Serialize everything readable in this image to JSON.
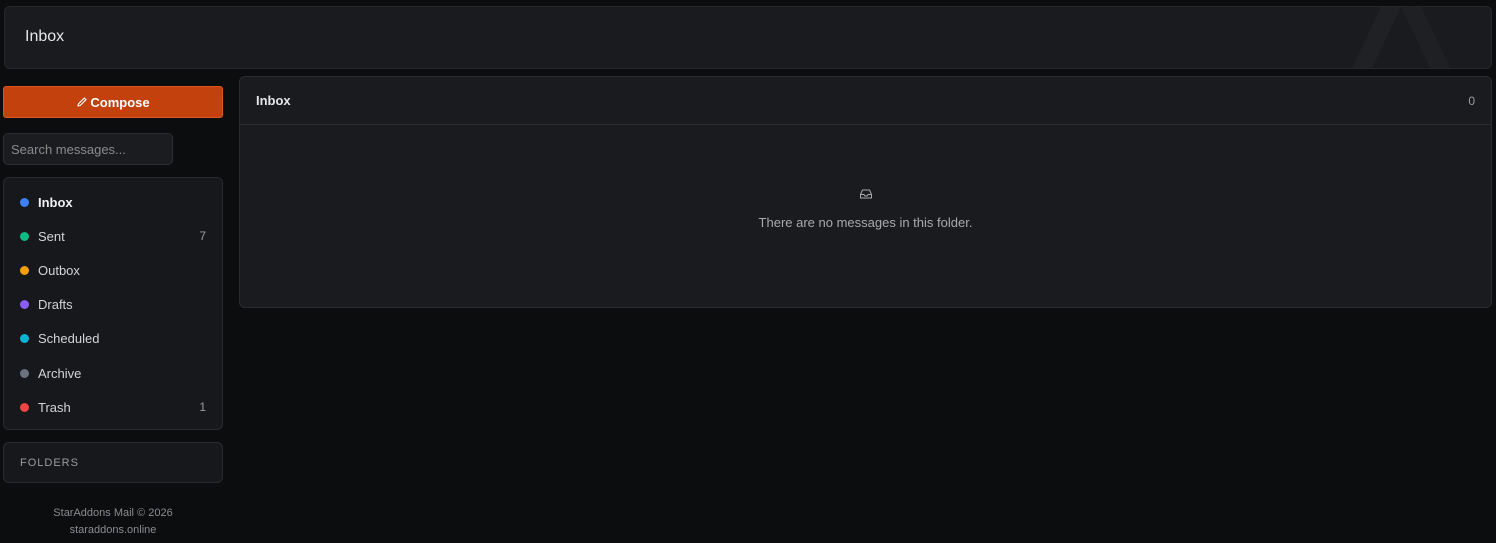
{
  "header": {
    "title": "Inbox"
  },
  "sidebar": {
    "compose_label": "Compose",
    "search_placeholder": "Search messages...",
    "items": [
      {
        "label": "Inbox",
        "count": "",
        "color": "#3b82f6",
        "active": true
      },
      {
        "label": "Sent",
        "count": "7",
        "color": "#10b981",
        "active": false
      },
      {
        "label": "Outbox",
        "count": "",
        "color": "#f59e0b",
        "active": false
      },
      {
        "label": "Drafts",
        "count": "",
        "color": "#8b5cf6",
        "active": false
      },
      {
        "label": "Scheduled",
        "count": "",
        "color": "#06b6d4",
        "active": false
      },
      {
        "label": "Archive",
        "count": "",
        "color": "#6b7280",
        "active": false
      },
      {
        "label": "Trash",
        "count": "1",
        "color": "#ef4444",
        "active": false
      }
    ],
    "folders_label": "FOLDERS",
    "footer_line1": "StarAddons Mail © 2026",
    "footer_line2": "staraddons.online"
  },
  "main": {
    "title": "Inbox",
    "count": "0",
    "empty_message": "There are no messages in this folder."
  },
  "colors": {
    "accent": "#c2410c",
    "background": "#0c0d0f",
    "surface": "#1a1b1e"
  },
  "icons": {
    "compose": "pencil-icon",
    "empty": "inbox-tray-icon"
  }
}
